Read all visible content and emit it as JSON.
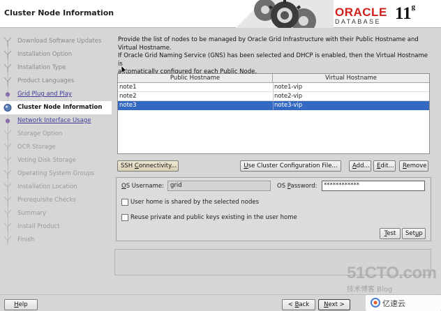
{
  "header": {
    "title": "Cluster Node Information",
    "brand": "ORACLE",
    "product": "DATABASE",
    "version": "11",
    "version_suffix": "g"
  },
  "steps": [
    {
      "label": "Download Software Updates",
      "state": "done"
    },
    {
      "label": "Installation Option",
      "state": "done"
    },
    {
      "label": "Installation Type",
      "state": "done"
    },
    {
      "label": "Product Languages",
      "state": "done"
    },
    {
      "label": "Grid Plug and Play",
      "state": "link"
    },
    {
      "label": "Cluster Node Information",
      "state": "current"
    },
    {
      "label": "Network Interface Usage",
      "state": "link"
    },
    {
      "label": "Storage Option",
      "state": "pending"
    },
    {
      "label": "OCR Storage",
      "state": "pending"
    },
    {
      "label": "Voting Disk Storage",
      "state": "pending"
    },
    {
      "label": "Operating System Groups",
      "state": "pending"
    },
    {
      "label": "Installation Location",
      "state": "pending"
    },
    {
      "label": "Prerequisite Checks",
      "state": "pending"
    },
    {
      "label": "Summary",
      "state": "pending"
    },
    {
      "label": "Install Product",
      "state": "pending"
    },
    {
      "label": "Finish",
      "state": "pending"
    }
  ],
  "instructions": {
    "line1": "Provide the list of nodes to be managed by Oracle Grid Infrastructure with their Public Hostname and",
    "line2": "Virtual Hostname.",
    "line3": "If Oracle Grid Naming Service (GNS) has been selected and DHCP is enabled, then the Virtual Hostname is",
    "line4": "automatically configured for each Public Node."
  },
  "table": {
    "headers": [
      "Public Hostname",
      "Virtual Hostname"
    ],
    "rows": [
      {
        "public": "note1",
        "virtual": "note1-vip",
        "selected": false
      },
      {
        "public": "note2",
        "virtual": "note2-vip",
        "selected": false
      },
      {
        "public": "note3",
        "virtual": "note3-vip",
        "selected": true
      }
    ]
  },
  "buttons": {
    "ssh_pre": "SSH ",
    "ssh_mn": "C",
    "ssh_post": "onnectivity...",
    "cluster_pre": "",
    "cluster_mn": "U",
    "cluster_post": "se Cluster Configuration File...",
    "add_pre": "",
    "add_mn": "A",
    "add_post": "dd...",
    "edit_pre": "",
    "edit_mn": "E",
    "edit_post": "dit...",
    "remove_pre": "",
    "remove_mn": "R",
    "remove_post": "emove",
    "test_pre": "",
    "test_mn": "T",
    "test_post": "est",
    "setup_pre": "Set",
    "setup_mn": "u",
    "setup_post": "p",
    "help_pre": "",
    "help_mn": "H",
    "help_post": "elp",
    "back_pre": "< ",
    "back_mn": "B",
    "back_post": "ack",
    "next_pre": "",
    "next_mn": "N",
    "next_post": "ext >"
  },
  "credentials": {
    "username_label_pre": "",
    "username_label_mn": "O",
    "username_label_post": "S Username:",
    "username_value": "grid",
    "password_label_pre": "OS ",
    "password_label_mn": "P",
    "password_label_post": "assword:",
    "password_value": "************",
    "user_home_shared_label": "User home is shared by the selected nodes",
    "user_home_shared_checked": false,
    "reuse_keys_label": "Reuse private and public keys existing in the user home",
    "reuse_keys_checked": false
  },
  "watermark": {
    "site": "51CTO.com",
    "tagline": "技术博客   Blog",
    "badge": "亿速云"
  },
  "colors": {
    "selection": "#3369c1",
    "oracle_red": "#d0201b",
    "link": "#3d3d99"
  }
}
